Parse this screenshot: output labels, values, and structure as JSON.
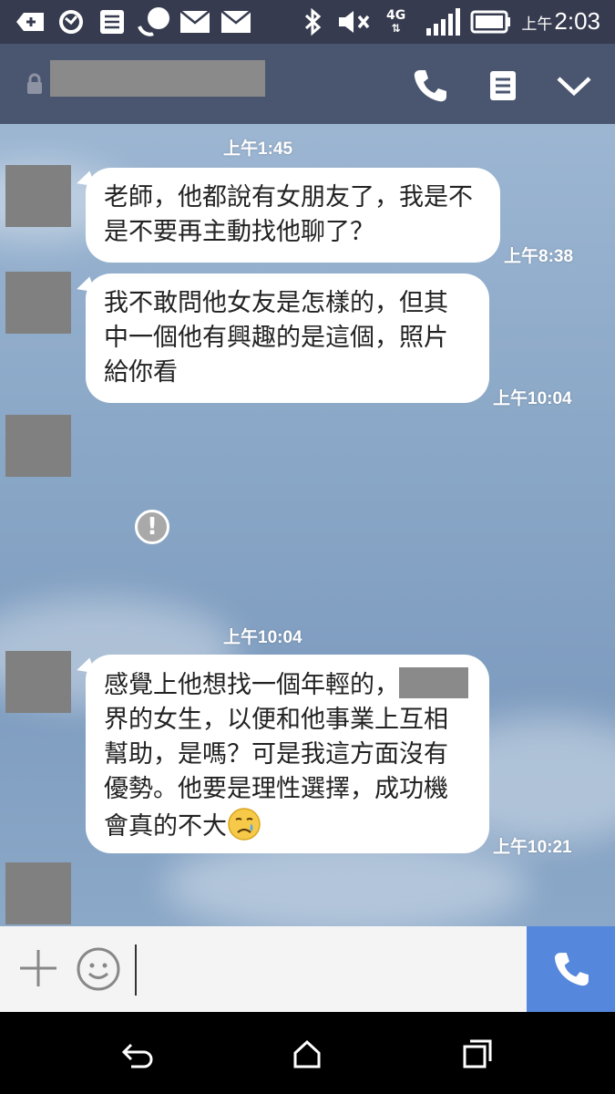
{
  "status_bar": {
    "network": "4G",
    "time_prefix": "上午",
    "time": "2:03"
  },
  "header": {
    "icons": [
      "lock-icon",
      "phone-icon",
      "notes-icon",
      "chevron-down-icon"
    ]
  },
  "chat": {
    "date_labels": [
      "上午1:45",
      "上午10:04"
    ],
    "messages": [
      {
        "text": "老師，他都說有女朋友了，我是不是不要再主動找他聊了？",
        "time": "上午8:38"
      },
      {
        "text": "我不敢問他女友是怎樣的，但其中一個他有興趣的是這個，照片給你看",
        "time": "上午10:04"
      },
      {
        "text_before": "感覺上他想找一個年輕的，",
        "text_after": "界的女生，以便和他事業上互相幫助，是嗎？可是我這方面沒有優勢。他要是理性選擇，成功機會真的不大",
        "time": "上午10:21",
        "emoji": "disappointed-face"
      }
    ],
    "warning_symbol": "!"
  },
  "input_bar": {
    "placeholder": ""
  },
  "colors": {
    "status_bar": "#363b4f",
    "header": "#4a5670",
    "call_button": "#5587dd",
    "chat_bg": "#8aa6c6"
  }
}
